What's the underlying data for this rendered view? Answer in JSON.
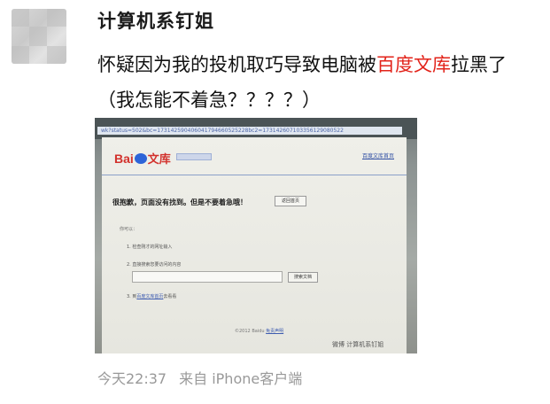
{
  "post": {
    "username": "计算机系钉姐",
    "text_line1_before": "怀疑因为我的投机取巧导致电脑被",
    "text_line1_highlight": "百度文库",
    "text_line1_after": "拉黑了",
    "text_line2": "（我怎能不着急？？？？）",
    "timestamp": "今天22:37",
    "source": "来自 iPhone客户端",
    "highlight_color": "#e2231a"
  },
  "photo": {
    "address_bar": "wk?status=502&bc=173142590406041794660525228bc2=173142607103356129080522",
    "logo_text_1": "Bai",
    "logo_text_2": "文库",
    "top_link": "百度文库首页",
    "error_message": "很抱歉，页面没有找到。但是不要着急哦！",
    "back_button": "返回首页",
    "tips_title": "你可以：",
    "tip_1": "1. 检查刚才的网址输入",
    "tip_2": "2. 直接搜索您要访问的内容",
    "search_button": "搜索文档",
    "tip_3_prefix": "3. 到",
    "tip_3_link": "百度文库首页",
    "tip_3_suffix": "去看看",
    "copyright_prefix": "©2012 Baidu",
    "copyright_link": "免责声明",
    "watermark": "微博 计算机系钉姐"
  }
}
